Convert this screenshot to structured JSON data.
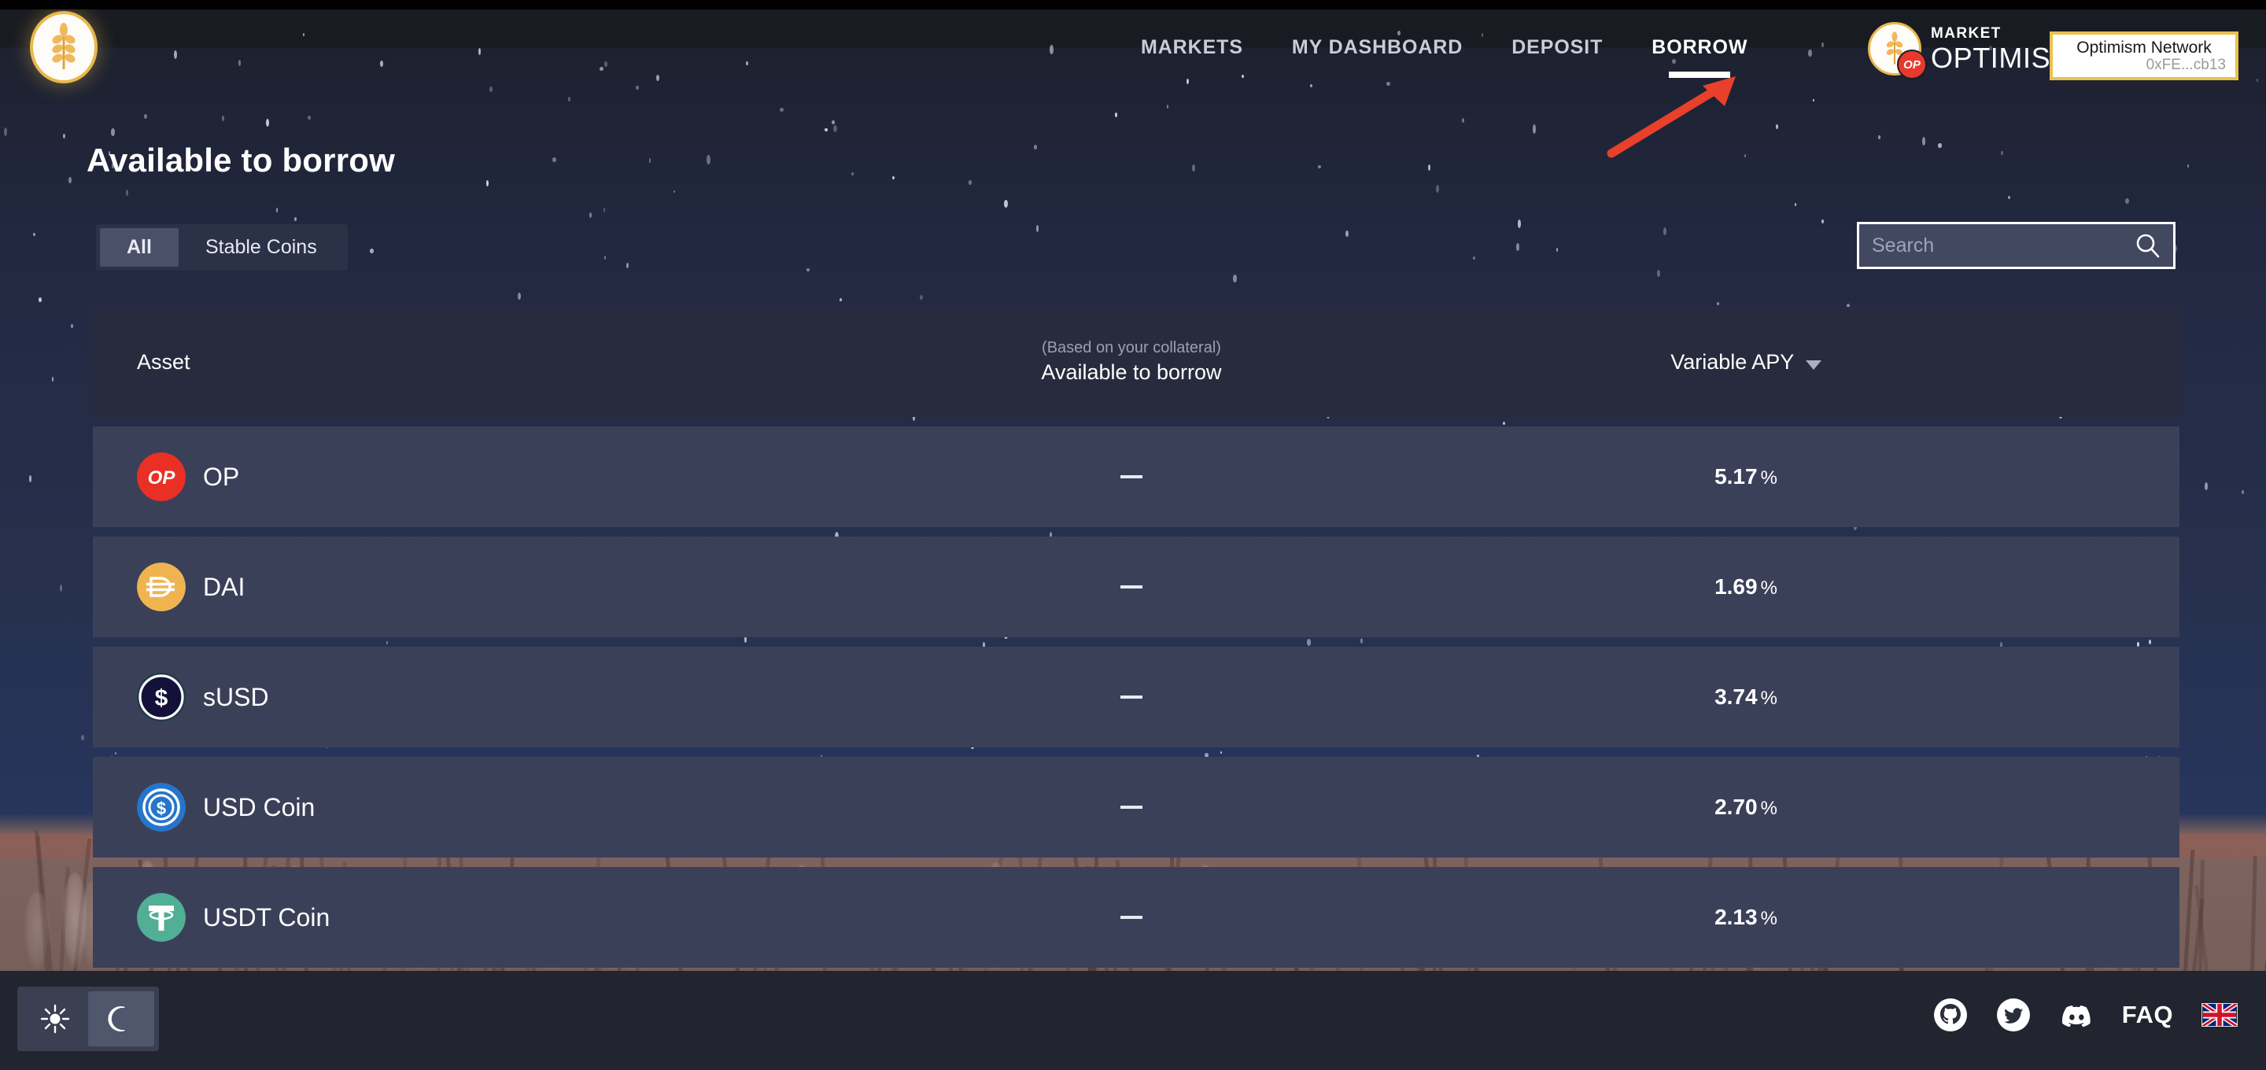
{
  "brand": {
    "logo_icon": "wheat-logo-icon",
    "market_label": "MARKET",
    "network_label": "OPTIMISM",
    "op_badge": "OP"
  },
  "nav": {
    "items": [
      {
        "label": "MARKETS",
        "active": false
      },
      {
        "label": "MY DASHBOARD",
        "active": false
      },
      {
        "label": "DEPOSIT",
        "active": false
      },
      {
        "label": "BORROW",
        "active": true
      }
    ]
  },
  "wallet": {
    "network": "Optimism Network",
    "address": "0xFE...cb13",
    "border_color": "#e8c14e"
  },
  "annotation": {
    "type": "arrow",
    "color": "#e8402a",
    "points_to": "BORROW"
  },
  "page": {
    "title": "Available to borrow"
  },
  "filters": {
    "tabs": [
      {
        "label": "All",
        "active": true
      },
      {
        "label": "Stable Coins",
        "active": false
      }
    ]
  },
  "search": {
    "placeholder": "Search",
    "value": "",
    "icon": "search-icon"
  },
  "table": {
    "columns": {
      "asset": "Asset",
      "available_sub": "(Based on your collateral)",
      "available": "Available to borrow",
      "apy": "Variable APY",
      "apy_sort_icon": "chevron-down-icon"
    },
    "rows": [
      {
        "asset": "OP",
        "icon": "op-coin-icon",
        "icon_color": "#ea2f24",
        "available": "—",
        "apy": "5.17",
        "apy_unit": "%"
      },
      {
        "asset": "DAI",
        "icon": "dai-coin-icon",
        "icon_color": "#efb450",
        "available": "—",
        "apy": "1.69",
        "apy_unit": "%"
      },
      {
        "asset": "sUSD",
        "icon": "susd-coin-icon",
        "icon_color": "#13103a",
        "available": "—",
        "apy": "3.74",
        "apy_unit": "%"
      },
      {
        "asset": "USD Coin",
        "icon": "usdc-coin-icon",
        "icon_color": "#2775ca",
        "available": "—",
        "apy": "2.70",
        "apy_unit": "%"
      },
      {
        "asset": "USDT Coin",
        "icon": "usdt-coin-icon",
        "icon_color": "#50af95",
        "available": "—",
        "apy": "2.13",
        "apy_unit": "%"
      }
    ]
  },
  "footer": {
    "theme": {
      "light_icon": "sun-icon",
      "dark_icon": "moon-icon",
      "active": "dark"
    },
    "links": [
      {
        "name": "github",
        "icon": "github-icon"
      },
      {
        "name": "twitter",
        "icon": "twitter-icon"
      },
      {
        "name": "discord",
        "icon": "discord-icon"
      }
    ],
    "faq_label": "FAQ",
    "language_flag": "uk-flag-icon"
  },
  "colors": {
    "accent_gold": "#e8c14e",
    "row_bg": "#3b4059",
    "header_bg": "#272b3d",
    "annotation_red": "#e8402a"
  }
}
